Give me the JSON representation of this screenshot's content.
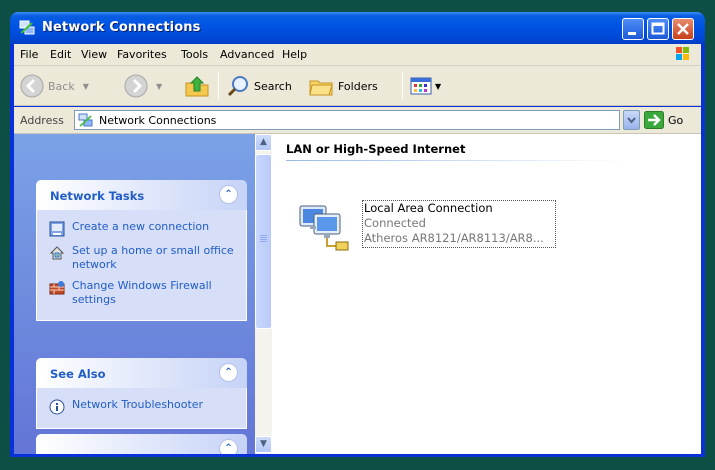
{
  "window": {
    "title": "Network Connections",
    "title_bar_color": "#0055e5"
  },
  "menu": [
    "File",
    "Edit",
    "View",
    "Favorites",
    "Tools",
    "Advanced",
    "Help"
  ],
  "toolbar": {
    "back_label": "Back",
    "search_label": "Search",
    "folders_label": "Folders"
  },
  "address": {
    "label": "Address",
    "value": "Network Connections",
    "go_label": "Go"
  },
  "taskpane": {
    "network_tasks": {
      "title": "Network Tasks",
      "collapse_glyph": "⌃",
      "items": [
        {
          "label": "Create a new connection",
          "icon": "new-connection-icon"
        },
        {
          "label": "Set up a home or small office network",
          "icon": "home-network-icon"
        },
        {
          "label": "Change Windows Firewall settings",
          "icon": "firewall-icon"
        }
      ]
    },
    "see_also": {
      "title": "See Also",
      "collapse_glyph": "⌃",
      "items": [
        {
          "label": "Network Troubleshooter",
          "icon": "info-icon"
        }
      ]
    }
  },
  "content": {
    "group_title": "LAN or High-Speed Internet",
    "connection": {
      "name": "Local Area Connection",
      "status": "Connected",
      "device": "Atheros AR8121/AR8113/AR8..."
    }
  },
  "colors": {
    "accent": "#215dc6",
    "taskpane_bg": "#7ba2e7",
    "panel_body": "#d6dff7"
  }
}
